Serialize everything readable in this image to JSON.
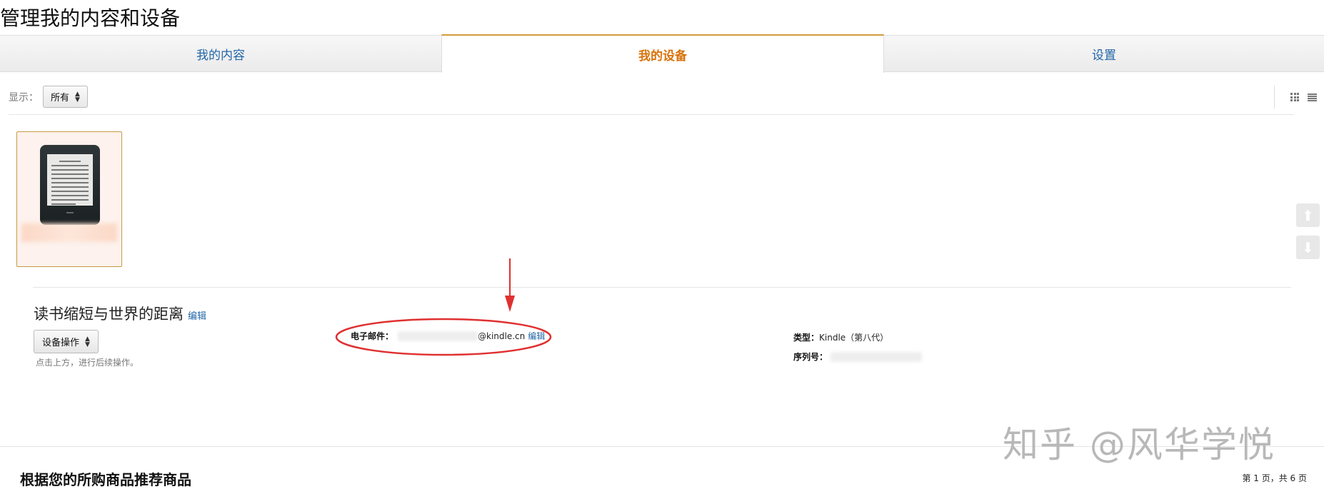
{
  "page_title": "管理我的内容和设备",
  "tabs": [
    {
      "label": "我的内容"
    },
    {
      "label": "我的设备"
    },
    {
      "label": "设置"
    }
  ],
  "filter": {
    "label": "显示：",
    "selected": "所有"
  },
  "device": {
    "name": "读书缩短与世界的距离",
    "edit_label": "编辑",
    "actions_label": "设备操作",
    "hint": "点击上方，进行后续操作。",
    "email_label": "电子邮件：",
    "email_domain": "@kindle.cn",
    "email_edit": "编辑",
    "type_label": "类型：",
    "type_value": "Kindle（第八代）",
    "serial_label": "序列号："
  },
  "recommend_title": "根据您的所购商品推荐商品",
  "pager": "第 1 页，共 6 页",
  "watermark": "知乎 @风华学悦",
  "colors": {
    "active_tab": "#d8730a",
    "link": "#2366a8",
    "annotation": "#e03030"
  }
}
